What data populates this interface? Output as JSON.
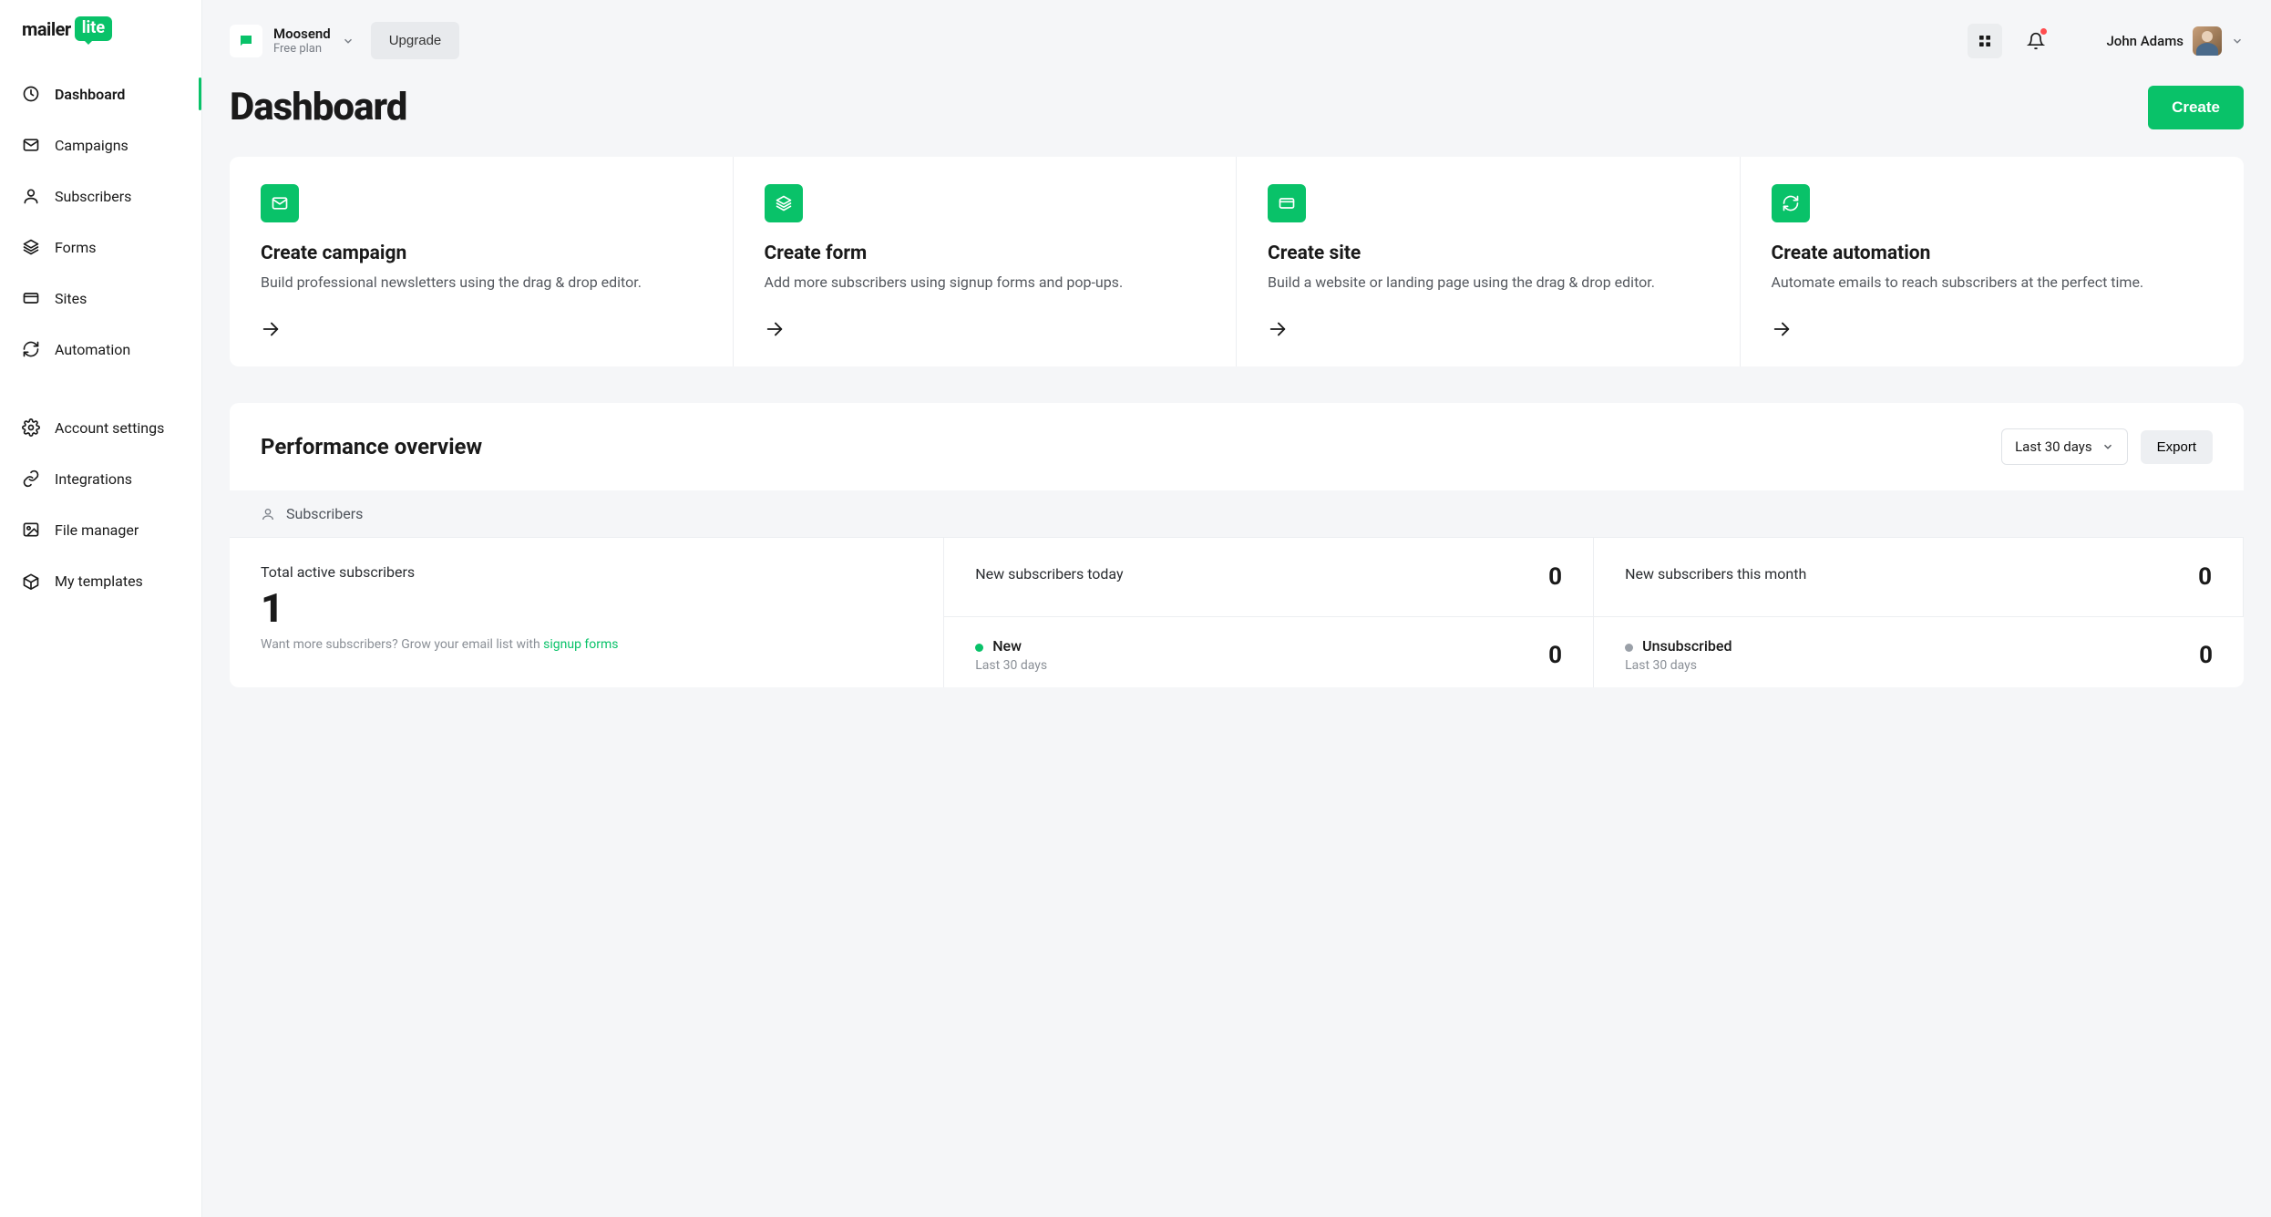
{
  "brand": {
    "mailer": "mailer",
    "lite": "lite"
  },
  "nav": {
    "primary": [
      {
        "label": "Dashboard",
        "active": true,
        "icon": "clock"
      },
      {
        "label": "Campaigns",
        "active": false,
        "icon": "mail"
      },
      {
        "label": "Subscribers",
        "active": false,
        "icon": "user"
      },
      {
        "label": "Forms",
        "active": false,
        "icon": "stack"
      },
      {
        "label": "Sites",
        "active": false,
        "icon": "card"
      },
      {
        "label": "Automation",
        "active": false,
        "icon": "refresh"
      }
    ],
    "secondary": [
      {
        "label": "Account settings",
        "icon": "gear"
      },
      {
        "label": "Integrations",
        "icon": "link"
      },
      {
        "label": "File manager",
        "icon": "image"
      },
      {
        "label": "My templates",
        "icon": "box"
      }
    ]
  },
  "topbar": {
    "workspace_name": "Moosend",
    "workspace_plan": "Free plan",
    "upgrade_label": "Upgrade",
    "user_name": "John Adams"
  },
  "page": {
    "title": "Dashboard",
    "create_label": "Create"
  },
  "action_cards": [
    {
      "title": "Create campaign",
      "desc": "Build professional newsletters using the drag & drop editor.",
      "icon": "mail"
    },
    {
      "title": "Create form",
      "desc": "Add more subscribers using signup forms and pop-ups.",
      "icon": "stack"
    },
    {
      "title": "Create site",
      "desc": "Build a website or landing page using the drag & drop editor.",
      "icon": "card"
    },
    {
      "title": "Create automation",
      "desc": "Automate emails to reach subscribers at the perfect time.",
      "icon": "refresh"
    }
  ],
  "performance": {
    "title": "Performance overview",
    "range_label": "Last 30 days",
    "export_label": "Export",
    "tab_label": "Subscribers",
    "total_label": "Total active subscribers",
    "total_value": "1",
    "hint_prefix": "Want more subscribers? ",
    "hint_grey": "Grow your email list with ",
    "hint_link": "signup forms",
    "new_today_label": "New subscribers today",
    "new_today_value": "0",
    "new_month_label": "New subscribers this month",
    "new_month_value": "0",
    "series": [
      {
        "name": "New",
        "color": "green",
        "period": "Last 30 days",
        "value": "0"
      },
      {
        "name": "Unsubscribed",
        "color": "grey",
        "period": "Last 30 days",
        "value": "0"
      }
    ]
  }
}
